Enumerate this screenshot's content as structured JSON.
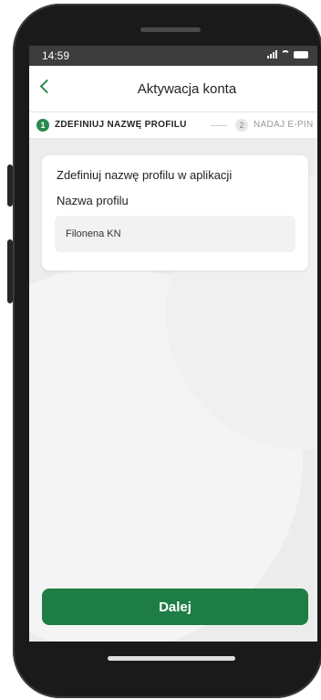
{
  "status_bar": {
    "time": "14:59",
    "icons": [
      "signal-icon",
      "wifi-icon",
      "battery-icon"
    ]
  },
  "header": {
    "title": "Aktywacja konta",
    "back_icon": "chevron-left-icon"
  },
  "stepper": {
    "steps": [
      {
        "number": "1",
        "label": "ZDEFINIUJ NAZWĘ PROFILU",
        "active": true
      },
      {
        "number": "2",
        "label": "NADAJ E-PIN",
        "active": false
      }
    ]
  },
  "card": {
    "heading": "Zdefiniuj nazwę profilu w aplikacji",
    "field_label": "Nazwa profilu",
    "field_value": "Filonena KN"
  },
  "footer": {
    "next_label": "Dalej"
  },
  "colors": {
    "accent": "#1e7d45",
    "back_arrow": "#2b8a4c",
    "screen_bg": "#ececec"
  }
}
